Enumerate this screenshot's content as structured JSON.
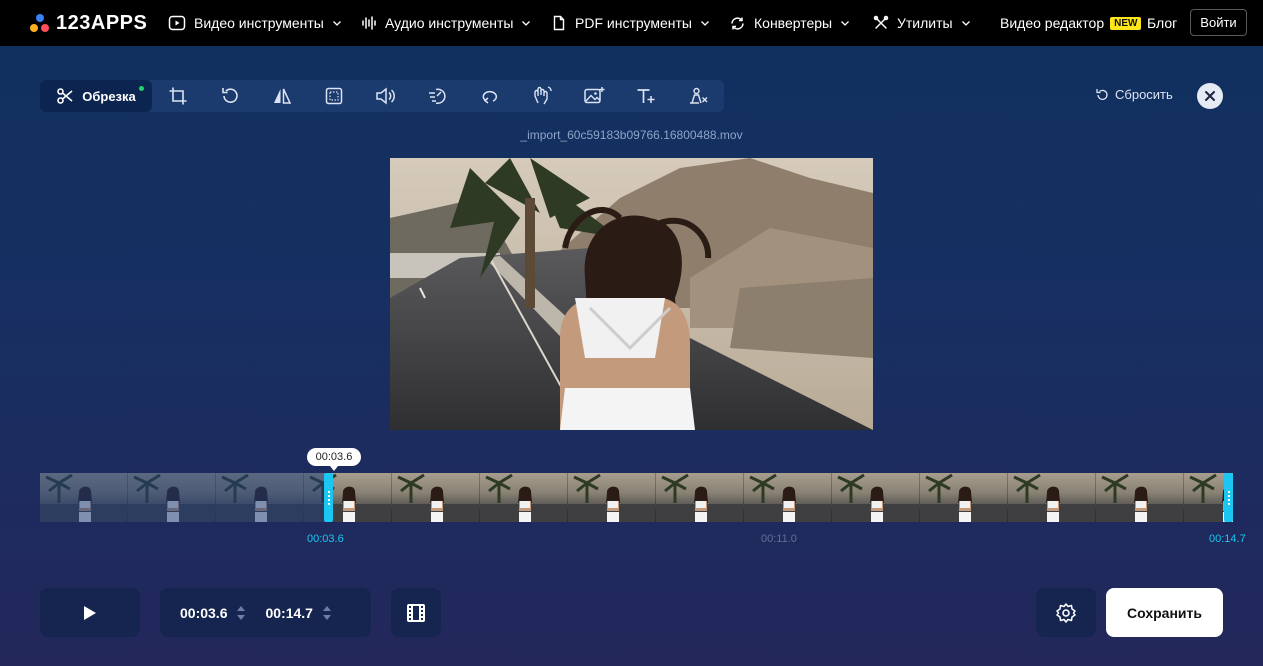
{
  "app": {
    "logo_text": "123APPS"
  },
  "nav": {
    "items": [
      {
        "label": "Видео инструменты",
        "icon": "play-circle-icon"
      },
      {
        "label": "Аудио инструменты",
        "icon": "waveform-icon"
      },
      {
        "label": "PDF инструменты",
        "icon": "document-icon"
      },
      {
        "label": "Конвертеры",
        "icon": "refresh-icon"
      },
      {
        "label": "Утилиты",
        "icon": "tools-icon"
      }
    ],
    "video_editor": "Видео редактор",
    "new_badge": "NEW",
    "blog": "Блог",
    "login": "Войти"
  },
  "toolbar": {
    "active_tool": "Обрезка",
    "tools": [
      "crop-icon",
      "rotate-icon",
      "flip-icon",
      "resize-icon",
      "volume-icon",
      "speed-icon",
      "loop-icon",
      "stabilize-icon",
      "image-icon",
      "text-icon",
      "remove-logo-icon"
    ],
    "reset_label": "Сбросить"
  },
  "file": {
    "name": "_import_60c59183b09766.16800488.mov"
  },
  "timeline": {
    "tooltip": "00:03.6",
    "start_label": "00:03.6",
    "mid_label": "00:11.0",
    "end_label": "00:14.7",
    "selected_start": 3.6,
    "selected_end": 14.7
  },
  "controls": {
    "start_time": "00:03.6",
    "end_time": "00:14.7",
    "save_label": "Сохранить"
  },
  "colors": {
    "accent": "#1cc6f2",
    "active_dot": "#22d36b",
    "new_badge": "#ffe61a"
  }
}
